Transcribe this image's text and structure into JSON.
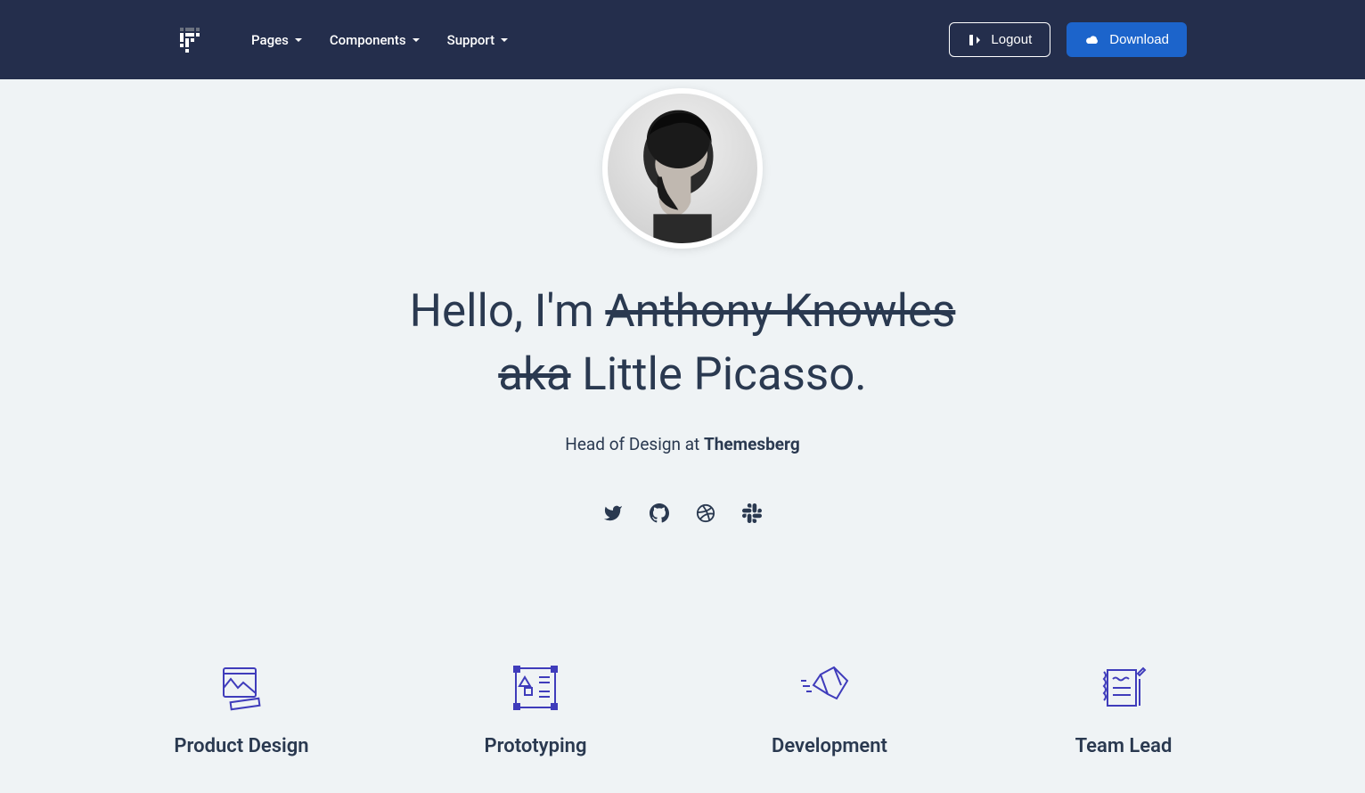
{
  "nav": {
    "links": [
      {
        "label": "Pages"
      },
      {
        "label": "Components"
      },
      {
        "label": "Support"
      }
    ],
    "logout": "Logout",
    "download": "Download"
  },
  "hero": {
    "greeting": "Hello, I'm ",
    "name_strike": "Anthony Knowles",
    "aka_strike": "aka",
    "nickname": " Little Picasso.",
    "role_prefix": "Head of Design at ",
    "company": "Themesberg"
  },
  "social": {
    "twitter": "twitter-icon",
    "github": "github-icon",
    "dribbble": "dribbble-icon",
    "slack": "slack-icon"
  },
  "features": [
    {
      "title": "Product Design"
    },
    {
      "title": "Prototyping"
    },
    {
      "title": "Development"
    },
    {
      "title": "Team Lead"
    }
  ]
}
